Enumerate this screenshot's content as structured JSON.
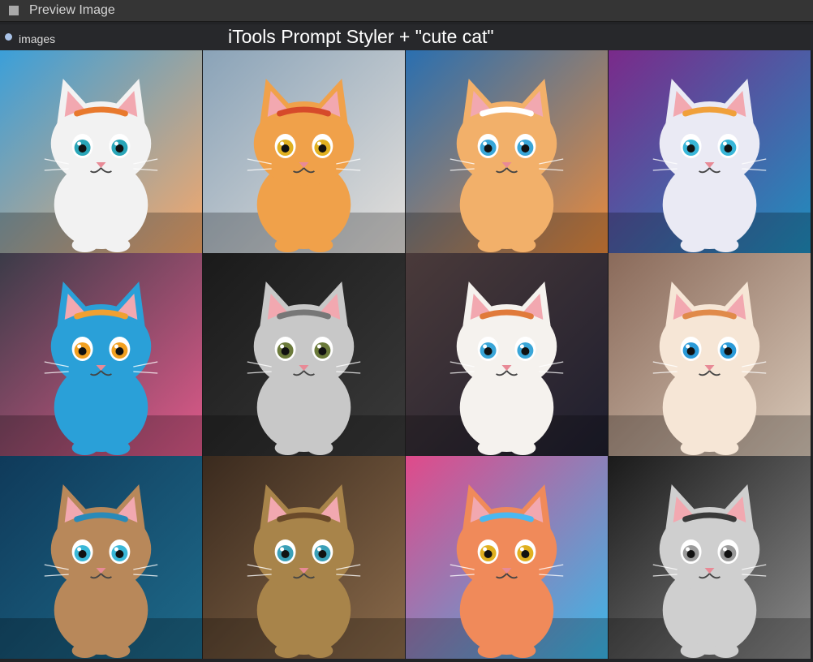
{
  "window": {
    "title": "Preview Image"
  },
  "output": {
    "label": "images"
  },
  "caption": "iTools Prompt Styler + \"cute cat\"",
  "images": [
    {
      "style": "anime city",
      "bg": [
        "#3b9fd9",
        "#f7a86a"
      ],
      "cat": "#f2f2f2",
      "accent": "#e8792d",
      "eye": "#2aa6b8"
    },
    {
      "style": "anime hero",
      "bg": [
        "#8aa3b8",
        "#e4e0dc"
      ],
      "cat": "#f0a14a",
      "accent": "#d64a2a",
      "eye": "#e0b020"
    },
    {
      "style": "fantasy window",
      "bg": [
        "#2a6fb0",
        "#e98a3c"
      ],
      "cat": "#f2b06a",
      "accent": "#ffffff",
      "eye": "#39a6d8"
    },
    {
      "style": "ornate frame",
      "bg": [
        "#7a2a8a",
        "#1f8fbf"
      ],
      "cat": "#eaeaf4",
      "accent": "#f0a03a",
      "eye": "#39b6d8"
    },
    {
      "style": "voxel blocks",
      "bg": [
        "#3b3b48",
        "#e05a8a"
      ],
      "cat": "#2aa0d8",
      "accent": "#f0a030",
      "eye": "#f2a020"
    },
    {
      "style": "studio portrait",
      "bg": [
        "#1a1a1a",
        "#3a3a3a"
      ],
      "cat": "#c8c8c8",
      "accent": "#777777",
      "eye": "#6b7a3a"
    },
    {
      "style": "toy balls",
      "bg": [
        "#4a3a3a",
        "#1e1e2e"
      ],
      "cat": "#f5f2ee",
      "accent": "#e07a3a",
      "eye": "#3aa6d8"
    },
    {
      "style": "cozy room",
      "bg": [
        "#8a6a5a",
        "#d8c8b8"
      ],
      "cat": "#f6e6d6",
      "accent": "#e08a4a",
      "eye": "#2a9ad8"
    },
    {
      "style": "cyber suit",
      "bg": [
        "#0f3a5a",
        "#1e6a8a"
      ],
      "cat": "#b8885a",
      "accent": "#2a8ab8",
      "eye": "#3ab8d8"
    },
    {
      "style": "steampunk",
      "bg": [
        "#3a2a1e",
        "#8a6a4a"
      ],
      "cat": "#a8844a",
      "accent": "#6a4a2a",
      "eye": "#3aa0b8"
    },
    {
      "style": "psychedelic",
      "bg": [
        "#e04a8a",
        "#3ab8e8"
      ],
      "cat": "#f08a5a",
      "accent": "#4ab8f0",
      "eye": "#e0b020"
    },
    {
      "style": "black and white",
      "bg": [
        "#1a1a1a",
        "#8a8a8a"
      ],
      "cat": "#cfcfcf",
      "accent": "#3a3a3a",
      "eye": "#9a9a9a"
    }
  ]
}
